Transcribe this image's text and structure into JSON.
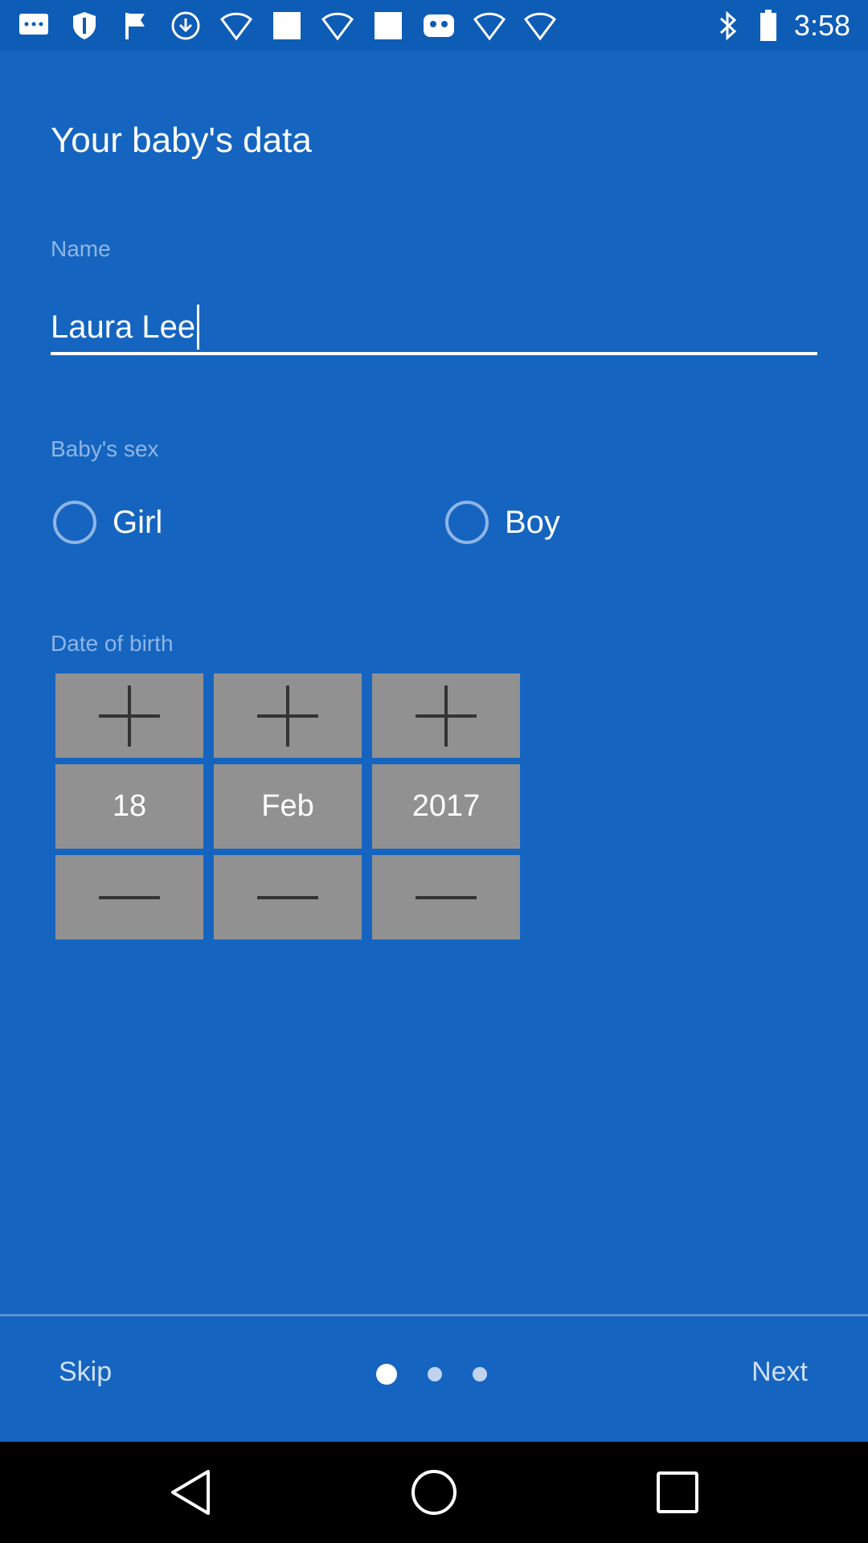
{
  "status_bar": {
    "time": "3:58",
    "left_icons": [
      "message-icon",
      "shield-icon",
      "flag-icon",
      "download-icon",
      "wifi-icon",
      "square-icon",
      "wifi-icon",
      "square-icon",
      "bot-icon",
      "wifi-icon",
      "wifi-icon"
    ],
    "right_icons": [
      "bluetooth-icon",
      "battery-icon"
    ]
  },
  "form": {
    "title": "Your baby's data",
    "name_label": "Name",
    "name_value": "Laura Lee",
    "sex_label": "Baby's sex",
    "sex_options": [
      "Girl",
      "Boy"
    ],
    "dob_label": "Date of birth",
    "dob": {
      "day": "18",
      "month": "Feb",
      "year": "2017"
    }
  },
  "footer": {
    "skip_label": "Skip",
    "next_label": "Next",
    "page_count": 3,
    "current_page": 1
  },
  "colors": {
    "background": "#1565C0",
    "status_bar": "#0D5CB6",
    "label": "#8FB5E6",
    "spinner": "#919191",
    "text": "#FFFFFF"
  }
}
